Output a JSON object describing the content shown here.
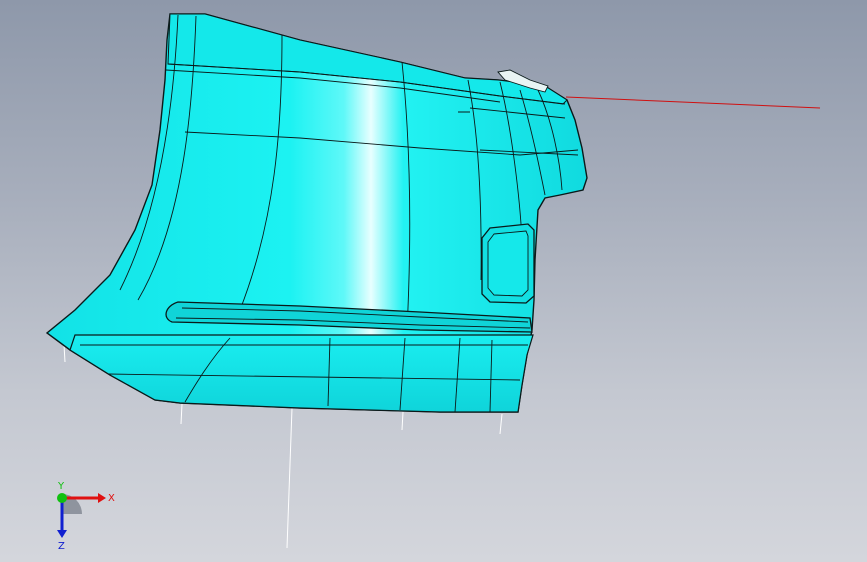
{
  "viewport": {
    "background_top": "#8e98aa",
    "background_bottom": "#d4d6dc"
  },
  "part": {
    "surface_color": "#17f0f0",
    "highlight_color": "#e8ffff",
    "edge_color": "#0a1a1a"
  },
  "reference_axis": {
    "color": "#d01010"
  },
  "triad": {
    "x_label": "X",
    "y_label": "Y",
    "z_label": "Z",
    "x_color": "#e01010",
    "y_color": "#10c010",
    "z_color": "#1020d0"
  }
}
